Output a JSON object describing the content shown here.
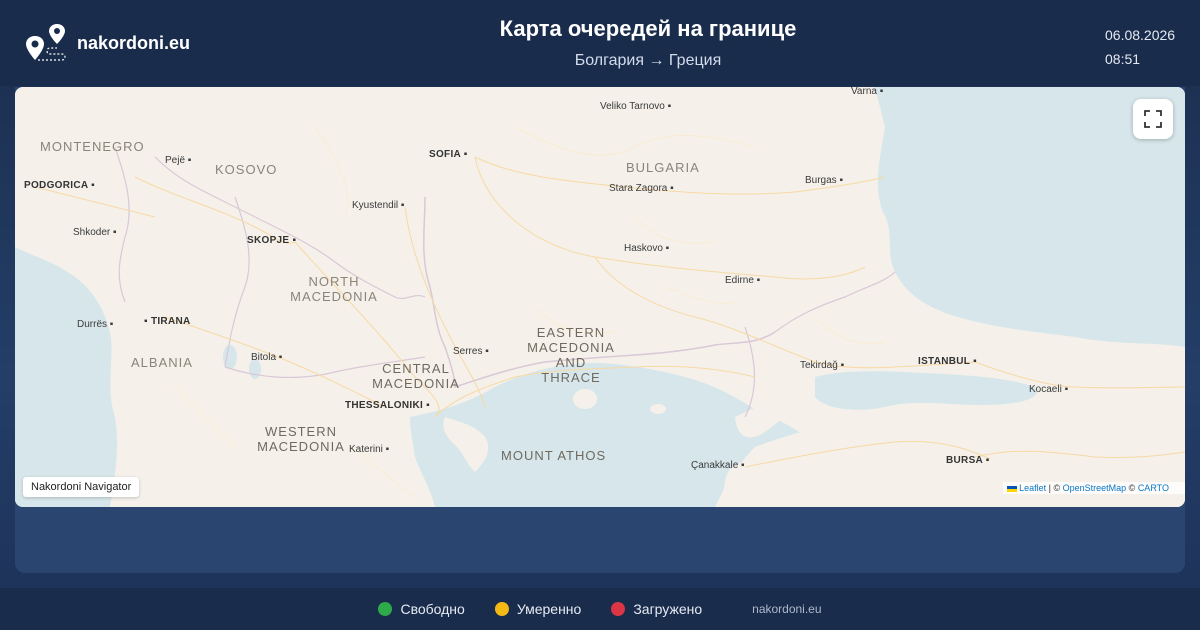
{
  "header": {
    "logo_text": "nakordoni.eu",
    "title": "Карта очередей на границе",
    "subtitle": "Болгария → Греция",
    "date": "06.08.2026",
    "time": "08:51"
  },
  "map": {
    "regions": [
      {
        "name": "MONTENEGRO"
      },
      {
        "name": "KOSOVO"
      },
      {
        "name": "BULGARIA"
      },
      {
        "name": "NORTH MACEDONIA"
      },
      {
        "name": "ALBANIA"
      },
      {
        "name": "EASTERN MACEDONIA AND THRACE"
      },
      {
        "name": "CENTRAL MACEDONIA"
      },
      {
        "name": "WESTERN MACEDONIA"
      },
      {
        "name": "MOUNT ATHOS"
      }
    ],
    "cities": [
      {
        "name": "Veliko Tarnovo"
      },
      {
        "name": "Varna"
      },
      {
        "name": "Pejë"
      },
      {
        "name": "PODGORICA"
      },
      {
        "name": "SOFIA"
      },
      {
        "name": "Stara Zagora"
      },
      {
        "name": "Burgas"
      },
      {
        "name": "Kyustendil"
      },
      {
        "name": "Shkoder"
      },
      {
        "name": "SKOPJE"
      },
      {
        "name": "Haskovo"
      },
      {
        "name": "Edirne"
      },
      {
        "name": "Durrës"
      },
      {
        "name": "TIRANA"
      },
      {
        "name": "Bitola"
      },
      {
        "name": "Serres"
      },
      {
        "name": "Tekirdağ"
      },
      {
        "name": "ISTANBUL"
      },
      {
        "name": "Kocaeli"
      },
      {
        "name": "THESSALONIKI"
      },
      {
        "name": "Katerini"
      },
      {
        "name": "Çanakkale"
      },
      {
        "name": "BURSA"
      }
    ],
    "nav_badge": "Nakordoni Navigator",
    "attribution": {
      "leaflet": "Leaflet",
      "sep1": " | © ",
      "osm": "OpenStreetMap",
      "sep2": " © ",
      "carto": "CARTO"
    },
    "fullscreen_icon": "fullscreen-icon"
  },
  "legend": [
    {
      "label": "Свободно",
      "color": "#2eaa4a"
    },
    {
      "label": "Умеренно",
      "color": "#f5b915"
    },
    {
      "label": "Загружено",
      "color": "#dc3545"
    }
  ],
  "footer_site": "nakordoni.eu"
}
